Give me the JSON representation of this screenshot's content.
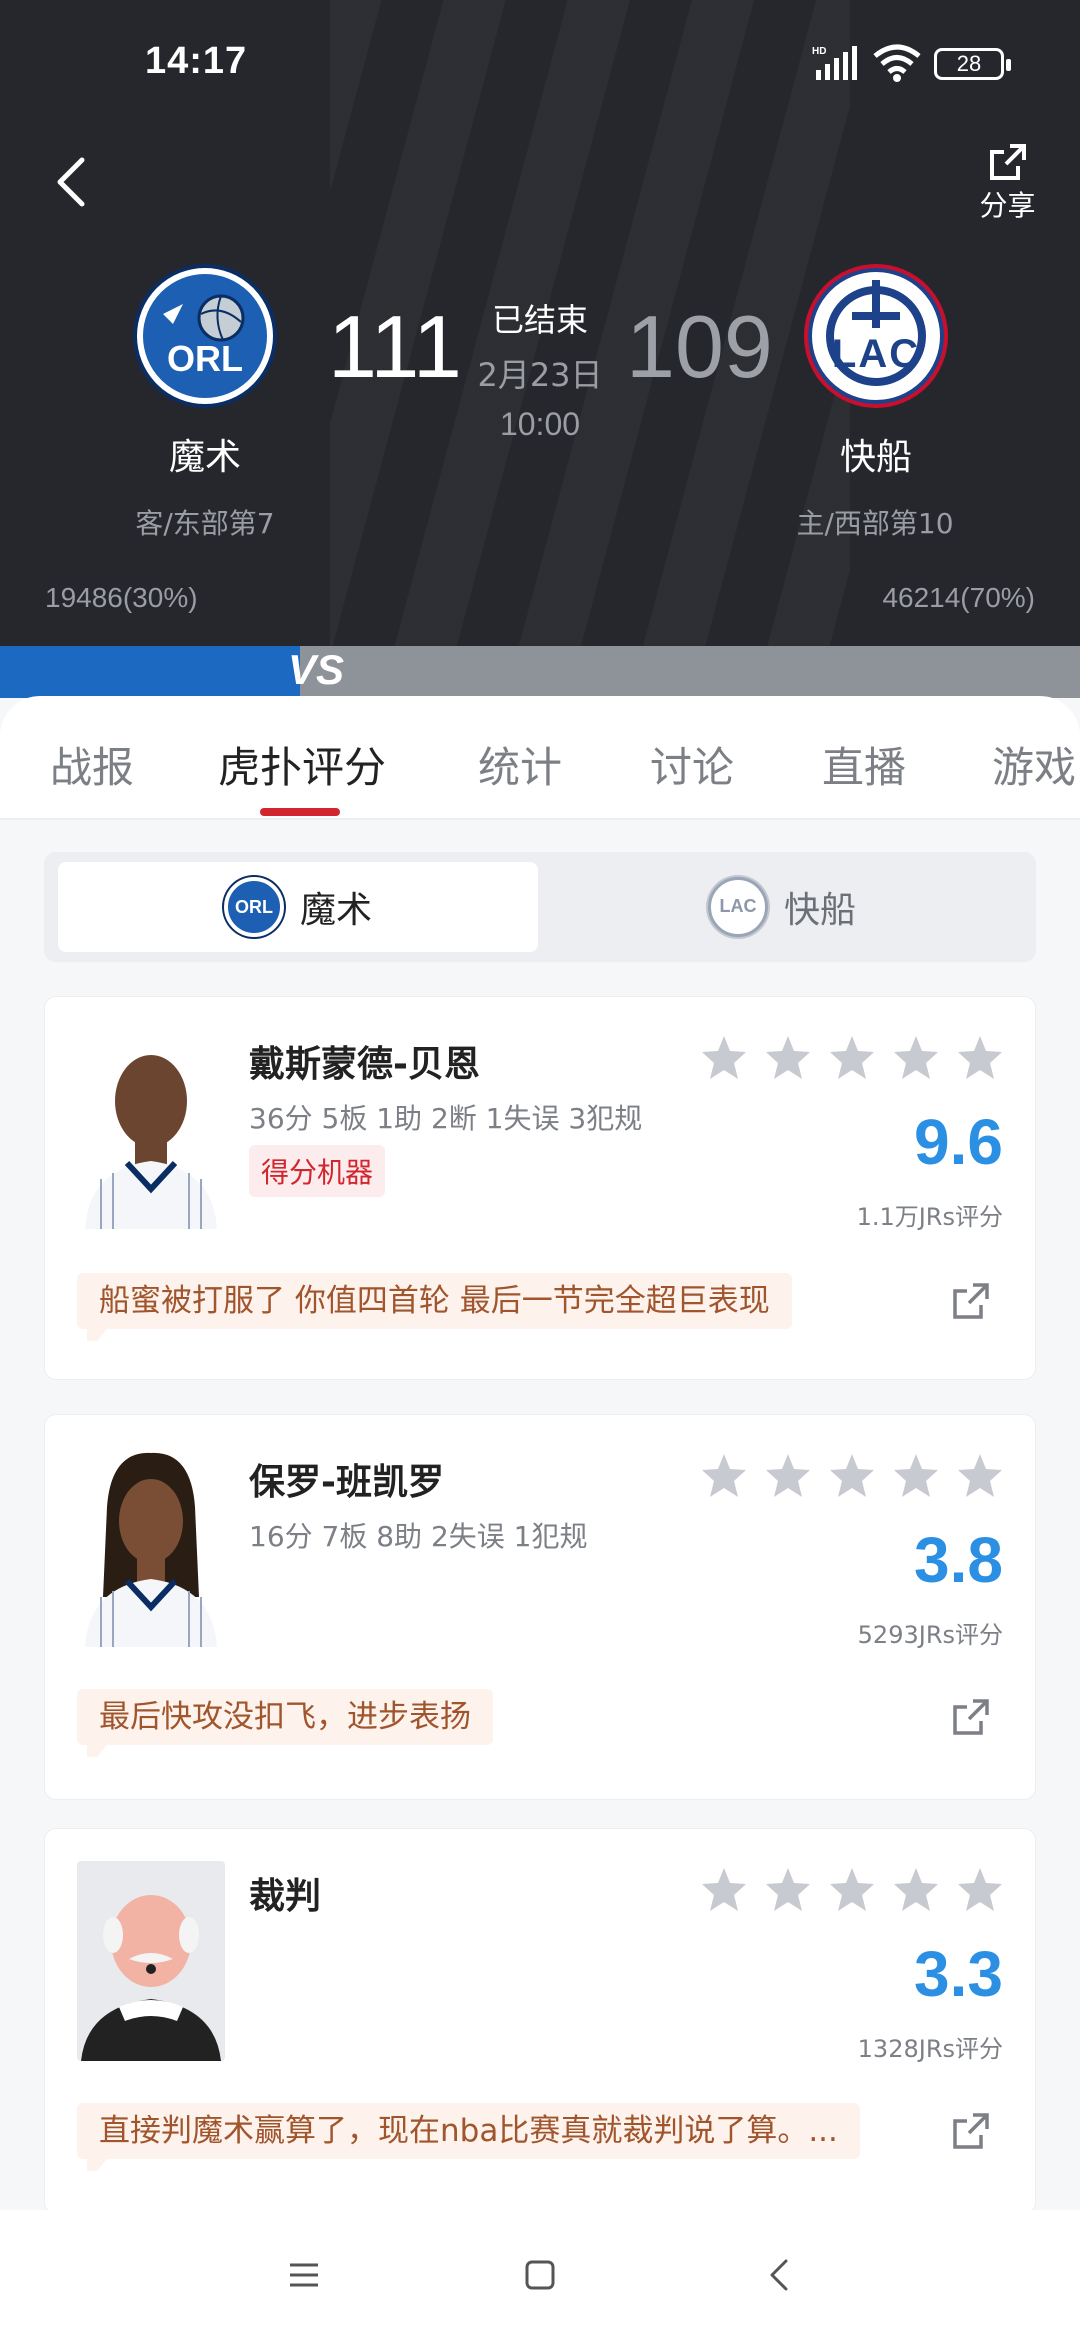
{
  "status_bar": {
    "time": "14:17",
    "battery": "28"
  },
  "header": {
    "share_label": "分享",
    "game_status": "已结束",
    "date": "2月23日",
    "time": "10:00",
    "away_team": {
      "abbr": "ORL",
      "name": "魔术",
      "sub": "客/东部第7",
      "score": "111",
      "support": "19486(30%)"
    },
    "home_team": {
      "abbr": "LAC",
      "name": "快船",
      "sub": "主/西部第10",
      "score": "109",
      "support": "46214(70%)"
    },
    "vs_label": "VS"
  },
  "tabs": [
    {
      "label": "战报"
    },
    {
      "label": "虎扑评分"
    },
    {
      "label": "统计"
    },
    {
      "label": "讨论"
    },
    {
      "label": "直播"
    },
    {
      "label": "游戏"
    }
  ],
  "team_switch": {
    "active": "魔术",
    "inactive": "快船"
  },
  "players": [
    {
      "name": "戴斯蒙德-贝恩",
      "stats": "36分 5板 1助 2断 1失误 3犯规",
      "tag": "得分机器",
      "rating": "9.6",
      "votes": "1.1万JRs评分",
      "comment": "船蜜被打服了 你值四首轮 最后一节完全超巨表现"
    },
    {
      "name": "保罗-班凯罗",
      "stats": "16分 7板 8助 2失误 1犯规",
      "tag": "",
      "rating": "3.8",
      "votes": "5293JRs评分",
      "comment": "最后快攻没扣飞，进步表扬"
    },
    {
      "name": "裁判",
      "stats": "",
      "tag": "",
      "rating": "3.3",
      "votes": "1328JRs评分",
      "comment": "直接判魔术赢算了，现在nba比赛真就裁判说了算。..."
    }
  ],
  "colors": {
    "header_bg": "#25272c",
    "accent_red": "#d1262d",
    "rating_blue": "#2b8fe3",
    "orl_blue": "#1c5fb3"
  }
}
